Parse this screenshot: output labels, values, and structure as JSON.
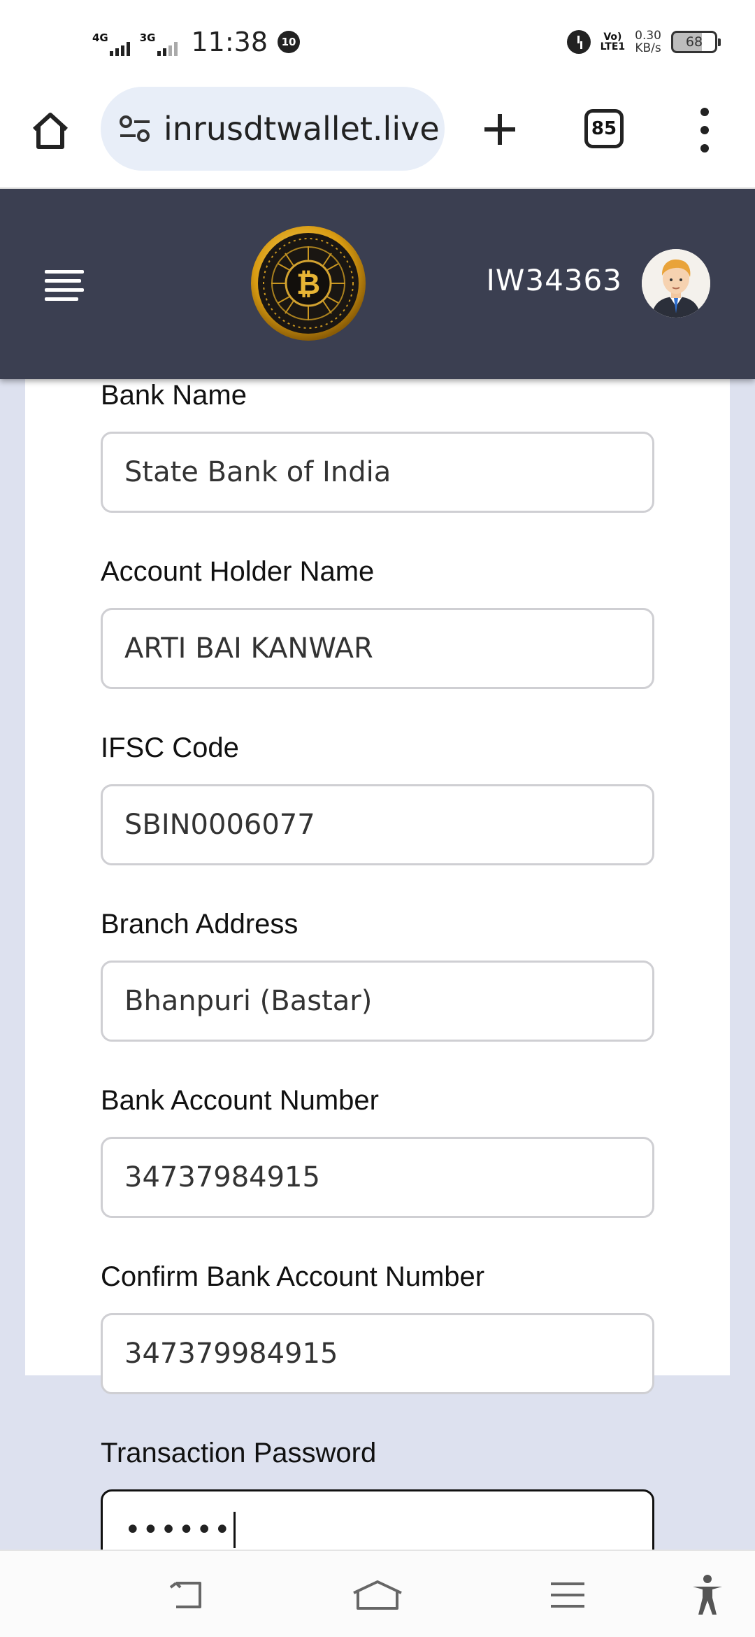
{
  "status_bar": {
    "network1": "4G",
    "network2": "3G",
    "time": "11:38",
    "notification_badge": "10",
    "volte": "Vo)\nLTE1",
    "speed_value": "0.30",
    "speed_unit": "KB/s",
    "battery_level": "68"
  },
  "browser": {
    "url": "inrusdtwallet.live",
    "tab_count": "85",
    "icons": [
      "home-icon",
      "site-settings-icon",
      "plus-icon",
      "tabs-icon",
      "more-vert-icon"
    ]
  },
  "header": {
    "user_id": "IW34363",
    "icons": [
      "hamburger-icon",
      "bitcoin-logo",
      "avatar"
    ],
    "bg_color": "#3b3f51"
  },
  "form": {
    "bank_name": {
      "label": "Bank Name",
      "value": "State Bank of India"
    },
    "account_holder": {
      "label": "Account Holder Name",
      "value": "ARTI BAI KANWAR"
    },
    "ifsc": {
      "label": "IFSC Code",
      "value": "SBIN0006077"
    },
    "branch": {
      "label": "Branch Address",
      "value": "Bhanpuri (Bastar)"
    },
    "account_number": {
      "label": "Bank Account Number",
      "value": "34737984915"
    },
    "confirm_account_number": {
      "label": "Confirm Bank Account Number",
      "value": "347379984915"
    },
    "transaction_password": {
      "label": "Transaction Password",
      "value": "••••••"
    }
  },
  "nav_bar": {
    "icons": [
      "back-icon",
      "home-icon",
      "recents-icon",
      "accessibility-icon"
    ]
  }
}
